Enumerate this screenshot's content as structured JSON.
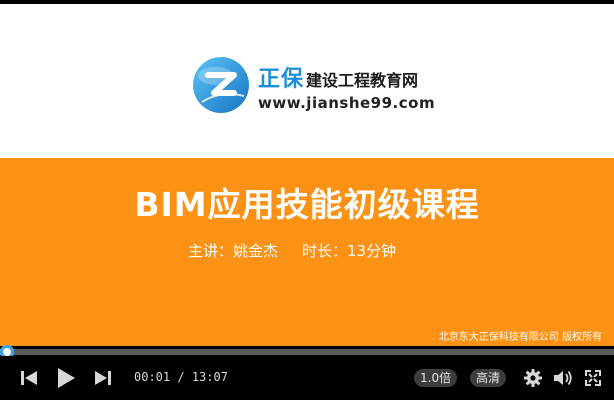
{
  "slide": {
    "brand_name": "正保",
    "brand_sub": "建设工程教育网",
    "brand_url": "www.jianshe99.com",
    "course_title": "BIM应用技能初级课程",
    "lecturer": "主讲：姚金杰",
    "duration": "时长：13分钟",
    "copyright": "北京东大正保科技有限公司  版权所有"
  },
  "player": {
    "current_time": "00:01",
    "total_time": "13:07",
    "progress_fraction": 0.0013,
    "speed_label": "1.0倍",
    "quality_label": "高清",
    "colors": {
      "accent": "#3aa0e8",
      "slide_orange": "#fb9215",
      "brand_blue": "#1d8ed8"
    },
    "icons": [
      "previous-icon",
      "play-icon",
      "next-icon",
      "settings-gear-icon",
      "volume-icon",
      "fullscreen-icon"
    ]
  }
}
